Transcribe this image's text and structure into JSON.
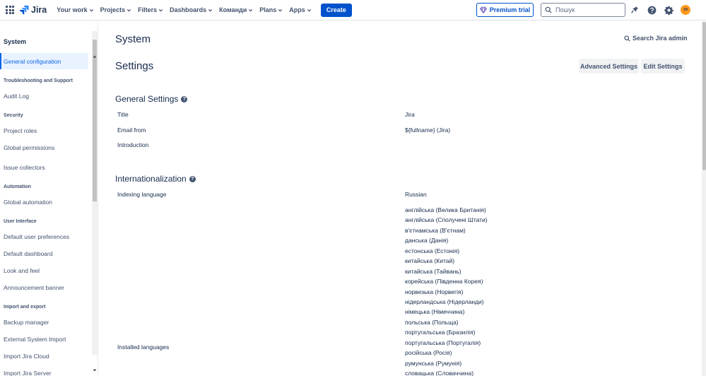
{
  "topnav": {
    "logo_text": "Jira",
    "menu": [
      "Your work",
      "Projects",
      "Filters",
      "Dashboards",
      "Команди",
      "Plans",
      "Apps"
    ],
    "create_label": "Create",
    "premium_label": "Premium trial",
    "search_placeholder": "Пошук",
    "avatar_initials": "OI"
  },
  "sidebar": {
    "title": "System",
    "active_item": "General configuration",
    "groups": [
      {
        "heading": "Troubleshooting and Support",
        "items": [
          "Audit Log"
        ]
      },
      {
        "heading": "Security",
        "items": [
          "Project roles",
          "Global permissions",
          "Issue collectors"
        ]
      },
      {
        "heading": "Automation",
        "items": [
          "Global automation"
        ]
      },
      {
        "heading": "User Interface",
        "items": [
          "Default user preferences",
          "Default dashboard",
          "Look and feel",
          "Announcement banner"
        ]
      },
      {
        "heading": "Import and export",
        "items": [
          "Backup manager",
          "External System Import",
          "Import Jira Cloud",
          "Import Jira Server"
        ]
      }
    ]
  },
  "main": {
    "page_title": "System",
    "search_admin_label": "Search Jira admin",
    "settings_title": "Settings",
    "advanced_settings_label": "Advanced Settings",
    "edit_settings_label": "Edit Settings",
    "general": {
      "heading": "General Settings",
      "rows": [
        {
          "label": "Title",
          "value": "Jira"
        },
        {
          "label": "Email from",
          "value": "${fullname} (Jira)"
        },
        {
          "label": "Introduction",
          "value": ""
        }
      ]
    },
    "i18n": {
      "heading": "Internationalization",
      "indexing_label": "Indexing language",
      "indexing_value": "Russian",
      "installed_label": "Installed languages",
      "installed_languages": [
        "англійська (Велика Британія)",
        "англійська (Сполучені Штати)",
        "в'єтнамська (В'єтнам)",
        "данська (Данія)",
        "естонська (Естонія)",
        "китайська (Китай)",
        "китайська (Тайвань)",
        "корейська (Південна Корея)",
        "норвезька (Норвегія)",
        "нідерландська (Нідерланди)",
        "німецька (Німеччина)",
        "польська (Польща)",
        "португальська (Бразилія)",
        "португальська (Португалія)",
        "російська (Росія)",
        "румунська (Румунія)",
        "словацька (Словаччина)"
      ]
    }
  },
  "colors": {
    "brand": "#0052cc",
    "active_bg": "#e9f2ff",
    "active_text": "#0c66e4",
    "avatar": "#ff991f"
  }
}
